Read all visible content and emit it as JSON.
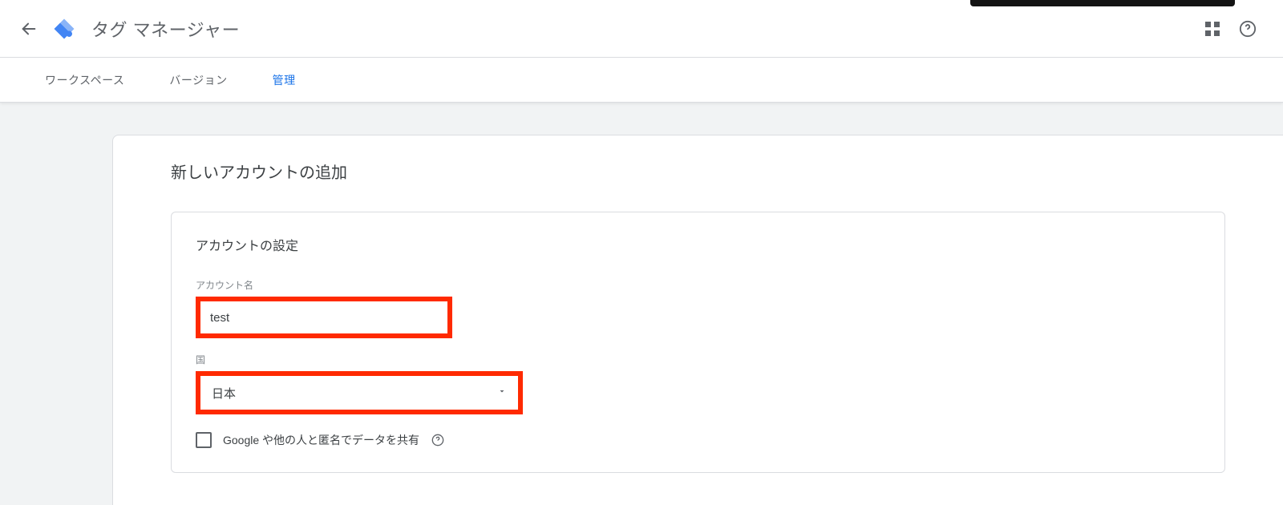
{
  "header": {
    "app_title": "タグ マネージャー"
  },
  "tabs": {
    "workspace": "ワークスペース",
    "versions": "バージョン",
    "admin": "管理"
  },
  "card": {
    "title": "新しいアカウントの追加"
  },
  "panel": {
    "title": "アカウントの設定",
    "account_name_label": "アカウント名",
    "account_name_value": "test",
    "country_label": "国",
    "country_value": "日本",
    "share_checkbox_label": "Google や他の人と匿名でデータを共有"
  }
}
